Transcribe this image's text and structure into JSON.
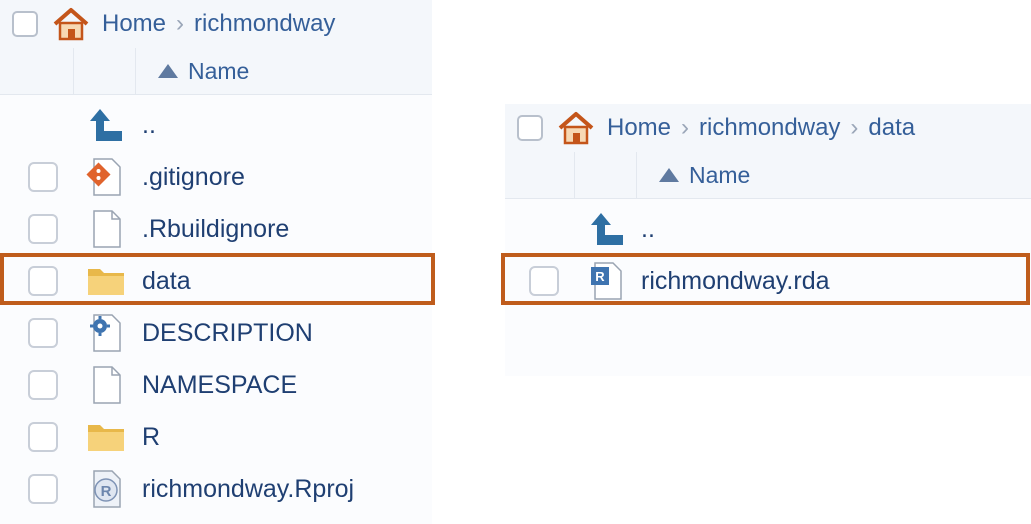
{
  "left": {
    "breadcrumb": [
      "Home",
      "richmondway"
    ],
    "column_name": "Name",
    "rows": [
      {
        "label": "..",
        "icon": "up-arrow-icon"
      },
      {
        "label": ".gitignore",
        "icon": "git-file-icon"
      },
      {
        "label": ".Rbuildignore",
        "icon": "blank-file-icon"
      },
      {
        "label": "data",
        "icon": "folder-icon",
        "highlighted": true
      },
      {
        "label": "DESCRIPTION",
        "icon": "gear-file-icon"
      },
      {
        "label": "NAMESPACE",
        "icon": "blank-file-icon"
      },
      {
        "label": "R",
        "icon": "folder-icon"
      },
      {
        "label": "richmondway.Rproj",
        "icon": "rproj-file-icon"
      }
    ]
  },
  "right": {
    "breadcrumb": [
      "Home",
      "richmondway",
      "data"
    ],
    "column_name": "Name",
    "rows": [
      {
        "label": "..",
        "icon": "up-arrow-icon"
      },
      {
        "label": "richmondway.rda",
        "icon": "rda-file-icon",
        "highlighted": true
      }
    ]
  },
  "colors": {
    "highlight": "#bf5c1c",
    "text": "#1f3f72",
    "breadcrumb": "#355f99"
  }
}
